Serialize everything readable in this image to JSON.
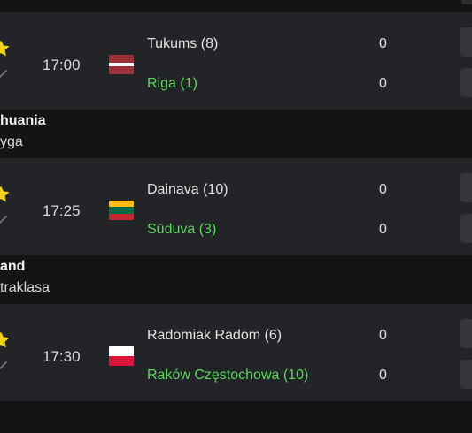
{
  "leagues": [
    {
      "country": "huania",
      "division": "yga"
    },
    {
      "country": "and",
      "division": "traklasa"
    }
  ],
  "matches": [
    {
      "time": "17:00",
      "flag": "latvia-flag",
      "home": {
        "team": "Tukums (8)",
        "score": "0"
      },
      "away": {
        "team": "Riga (1)",
        "score": "0"
      }
    },
    {
      "time": "17:25",
      "flag": "lithuania-flag",
      "home": {
        "team": "Dainava (10)",
        "score": "0"
      },
      "away": {
        "team": "Sūduva (3)",
        "score": "0"
      }
    },
    {
      "time": "17:30",
      "flag": "poland-flag",
      "home": {
        "team": "Radomiak Radom (6)",
        "score": "0"
      },
      "away": {
        "team": "Raków Częstochowa (10)",
        "score": "0"
      }
    }
  ],
  "colors": {
    "page_bg": "#141414",
    "row_bg": "#222427",
    "favorite_team": "#5fd55f",
    "star": "#f2d21b",
    "button_bg": "#34363a"
  }
}
